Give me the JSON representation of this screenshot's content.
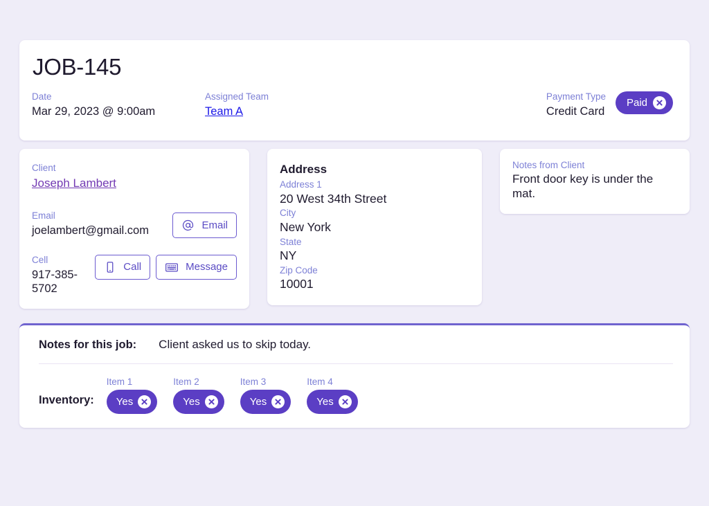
{
  "theme": {
    "page_background": "#efedf8",
    "card_background": "#ffffff",
    "accent_purple": "#5b3ec4",
    "label_color": "#7d80d6",
    "link_blue": "#1a16e8",
    "link_purple": "#7239b3",
    "top_border": "#6f63cf"
  },
  "header": {
    "title": "JOB-145",
    "date": {
      "label": "Date",
      "value": "Mar 29, 2023 @ 9:00am"
    },
    "assigned_team": {
      "label": "Assigned Team",
      "value": "Team A"
    },
    "payment": {
      "label": "Payment Type",
      "value": "Credit Card",
      "badge_label": "Paid",
      "badge_remove_icon": "close-circle-icon"
    }
  },
  "client_card": {
    "client_label": "Client",
    "client_name": "Joseph Lambert",
    "email_label": "Email",
    "email_value": "joelambert@gmail.com",
    "email_button": {
      "label": "Email",
      "icon": "at-sign-icon"
    },
    "cell_label": "Cell",
    "cell_value": "917-385-5702",
    "call_button": {
      "label": "Call",
      "icon": "mobile-phone-icon"
    },
    "message_button": {
      "label": "Message",
      "icon": "keyboard-icon"
    }
  },
  "address_card": {
    "title": "Address",
    "fields": [
      {
        "label": "Address 1",
        "value": "20 West 34th Street"
      },
      {
        "label": "City",
        "value": "New York"
      },
      {
        "label": "State",
        "value": "NY"
      },
      {
        "label": "Zip Code",
        "value": "10001"
      }
    ]
  },
  "client_notes_card": {
    "label": "Notes from Client",
    "value": "Front door key is under the mat."
  },
  "job_notes": {
    "label": "Notes for this job:",
    "value": "Client asked us to skip today."
  },
  "inventory": {
    "label": "Inventory:",
    "items": [
      {
        "label": "Item 1",
        "value": "Yes",
        "remove_icon": "close-circle-icon"
      },
      {
        "label": "Item 2",
        "value": "Yes",
        "remove_icon": "close-circle-icon"
      },
      {
        "label": "Item 3",
        "value": "Yes",
        "remove_icon": "close-circle-icon"
      },
      {
        "label": "Item 4",
        "value": "Yes",
        "remove_icon": "close-circle-icon"
      }
    ]
  }
}
